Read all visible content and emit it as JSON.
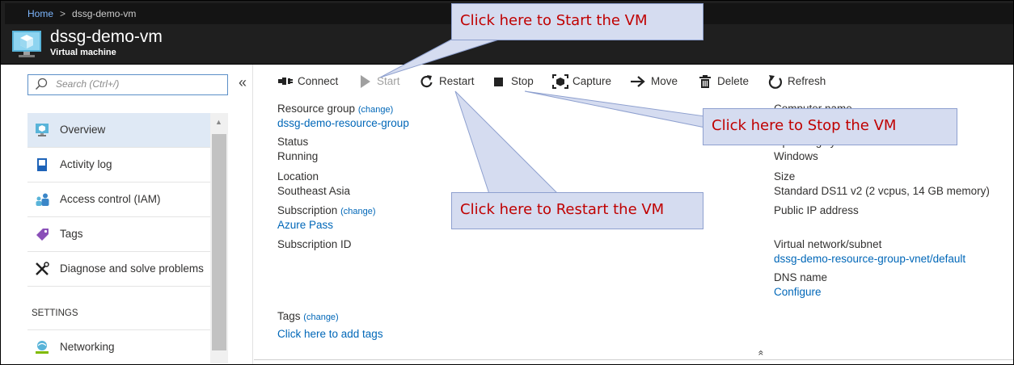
{
  "breadcrumb": {
    "home": "Home",
    "separator": ">",
    "current": "dssg-demo-vm"
  },
  "resource": {
    "title": "dssg-demo-vm",
    "subtitle": "Virtual machine",
    "icon": "vm-cube-icon"
  },
  "search": {
    "placeholder": "Search (Ctrl+/)",
    "value": ""
  },
  "sidebar": {
    "collapse_label": "«",
    "items": [
      {
        "label": "Overview",
        "icon": "vm-icon",
        "active": true
      },
      {
        "label": "Activity log",
        "icon": "activity-log-icon"
      },
      {
        "label": "Access control (IAM)",
        "icon": "people-icon"
      },
      {
        "label": "Tags",
        "icon": "tag-icon"
      },
      {
        "label": "Diagnose and solve problems",
        "icon": "wrench-icon"
      }
    ],
    "settings_header": "SETTINGS",
    "settings_items": [
      {
        "label": "Networking",
        "icon": "network-icon"
      }
    ]
  },
  "toolbar": {
    "connect": "Connect",
    "start": "Start",
    "restart": "Restart",
    "stop": "Stop",
    "capture": "Capture",
    "move": "Move",
    "delete": "Delete",
    "refresh": "Refresh"
  },
  "essentials": {
    "change_label": "(change)",
    "resource_group_label": "Resource group",
    "resource_group_value": "dssg-demo-resource-group",
    "status_label": "Status",
    "status_value": "Running",
    "location_label": "Location",
    "location_value": "Southeast Asia",
    "subscription_label": "Subscription",
    "subscription_value": "Azure Pass",
    "subscription_id_label": "Subscription ID",
    "computer_name_label": "Computer name",
    "os_label": "Operating system",
    "os_value": "Windows",
    "size_label": "Size",
    "size_value": "Standard DS11 v2 (2 vcpus, 14 GB memory)",
    "public_ip_label": "Public IP address",
    "vnet_label": "Virtual network/subnet",
    "vnet_value": "dssg-demo-resource-group-vnet/default",
    "dns_label": "DNS name",
    "dns_value": "Configure",
    "tags_label": "Tags",
    "tags_link": "Click here to add tags",
    "collapse_chevron": "«"
  },
  "callouts": {
    "start": "Click here to Start the VM",
    "stop": "Click here to Stop the VM",
    "restart": "Click here to Restart the VM"
  },
  "colors": {
    "link": "#0067b8",
    "callout_text": "#c00000",
    "callout_bg": "#d5dcf0",
    "header_bg": "#1f1f1f"
  }
}
